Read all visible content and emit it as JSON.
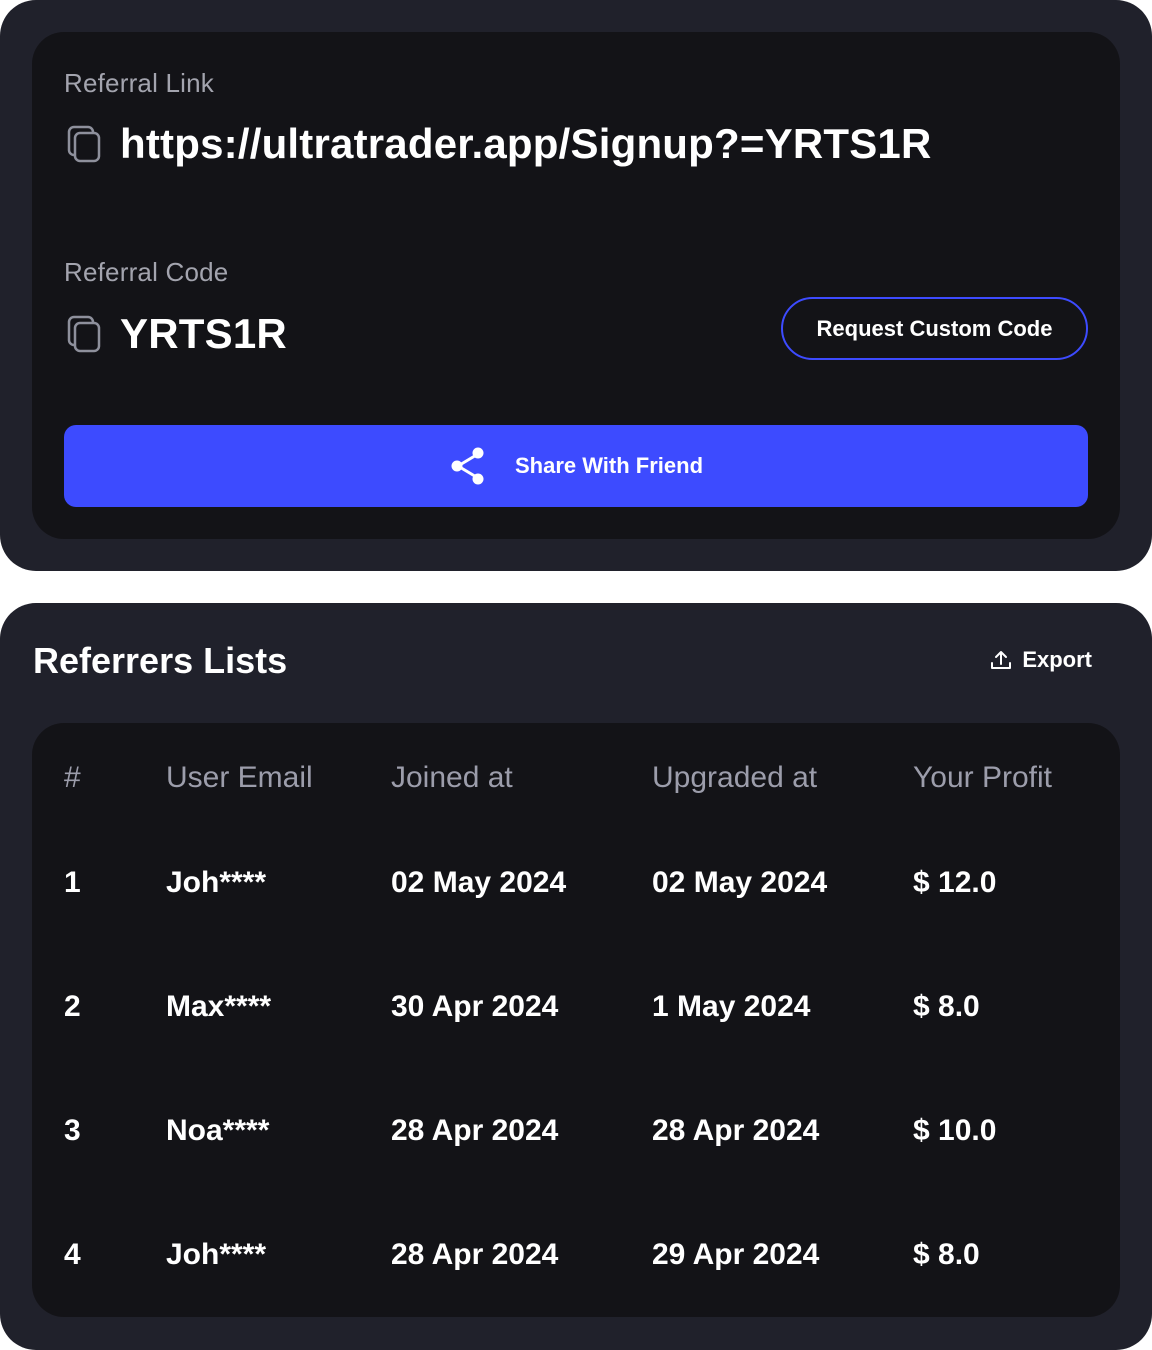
{
  "referral": {
    "link_label": "Referral Link",
    "link_value": "https://ultratrader.app/Signup?=YRTS1R",
    "code_label": "Referral Code",
    "code_value": "YRTS1R",
    "request_button": "Request Custom Code",
    "share_button": "Share With Friend"
  },
  "referrers": {
    "title": "Referrers Lists",
    "export_label": "Export",
    "columns": [
      "#",
      "User Email",
      "Joined at",
      "Upgraded at",
      "Your Profit"
    ],
    "rows": [
      {
        "num": "1",
        "email": "Joh****",
        "joined": "02 May 2024",
        "upgraded": "02 May 2024",
        "profit": "$ 12.0"
      },
      {
        "num": "2",
        "email": "Max****",
        "joined": "30 Apr 2024",
        "upgraded": "1 May 2024",
        "profit": "$ 8.0"
      },
      {
        "num": "3",
        "email": "Noa****",
        "joined": "28 Apr 2024",
        "upgraded": "28 Apr 2024",
        "profit": "$ 10.0"
      },
      {
        "num": "4",
        "email": "Joh****",
        "joined": "28 Apr 2024",
        "upgraded": "29 Apr 2024",
        "profit": "$ 8.0"
      }
    ]
  },
  "colors": {
    "accent": "#3d4bff",
    "card_bg": "#20212b",
    "panel_bg": "#131317",
    "muted_text": "#a3a4ae"
  },
  "icons": {
    "copy": "copy-icon",
    "share": "share-icon",
    "export": "upload-icon"
  }
}
